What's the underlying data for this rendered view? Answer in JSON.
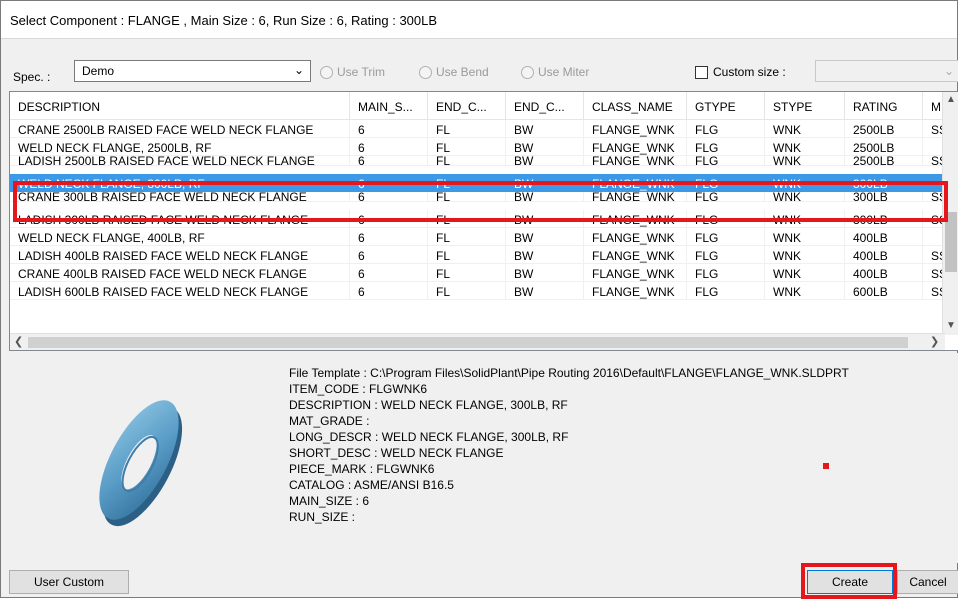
{
  "title": "Select Component : FLANGE , Main Size : 6, Run Size : 6, Rating : 300LB",
  "spec": {
    "label": "Spec. :",
    "selected": "Demo",
    "use_trim": "Use Trim",
    "use_bend": "Use Bend",
    "use_miter": "Use Miter",
    "custom_size": "Custom size :"
  },
  "table": {
    "headers": [
      "DESCRIPTION",
      "MAIN_S...",
      "END_C...",
      "END_C...",
      "CLASS_NAME",
      "GTYPE",
      "STYPE",
      "RATING",
      "M"
    ],
    "rows": [
      [
        "CRANE 2500LB RAISED FACE WELD NECK FLANGE",
        "6",
        "FL",
        "BW",
        "FLANGE_WNK",
        "FLG",
        "WNK",
        "2500LB",
        "SS"
      ],
      [
        "WELD NECK FLANGE, 2500LB, RF",
        "6",
        "FL",
        "BW",
        "FLANGE_WNK",
        "FLG",
        "WNK",
        "2500LB",
        ""
      ],
      [
        "LADISH 2500LB RAISED FACE WELD NECK FLANGE",
        "6",
        "FL",
        "BW",
        "FLANGE_WNK",
        "FLG",
        "WNK",
        "2500LB",
        "SS"
      ],
      [
        "WELD NECK FLANGE, 300LB, RF",
        "6",
        "FL",
        "BW",
        "FLANGE_WNK",
        "FLG",
        "WNK",
        "300LB",
        ""
      ],
      [
        "CRANE 300LB RAISED FACE WELD NECK FLANGE",
        "6",
        "FL",
        "BW",
        "FLANGE_WNK",
        "FLG",
        "WNK",
        "300LB",
        "SS"
      ],
      [
        "LADISH 300LB RAISED FACE WELD NECK FLANGE",
        "6",
        "FL",
        "BW",
        "FLANGE_WNK",
        "FLG",
        "WNK",
        "300LB",
        "SS"
      ],
      [
        "WELD NECK FLANGE, 400LB, RF",
        "6",
        "FL",
        "BW",
        "FLANGE_WNK",
        "FLG",
        "WNK",
        "400LB",
        ""
      ],
      [
        "LADISH 400LB RAISED FACE WELD NECK FLANGE",
        "6",
        "FL",
        "BW",
        "FLANGE_WNK",
        "FLG",
        "WNK",
        "400LB",
        "SS"
      ],
      [
        "CRANE 400LB RAISED FACE WELD NECK FLANGE",
        "6",
        "FL",
        "BW",
        "FLANGE_WNK",
        "FLG",
        "WNK",
        "400LB",
        "SS"
      ],
      [
        "LADISH 600LB RAISED FACE WELD NECK FLANGE",
        "6",
        "FL",
        "BW",
        "FLANGE_WNK",
        "FLG",
        "WNK",
        "600LB",
        "SS"
      ]
    ],
    "selected_index": 3
  },
  "info": {
    "file_template": "File Template : C:\\Program Files\\SolidPlant\\Pipe Routing 2016\\Default\\FLANGE\\FLANGE_WNK.SLDPRT",
    "item_code": "ITEM_CODE : FLGWNK6",
    "description": "DESCRIPTION : WELD NECK FLANGE, 300LB, RF",
    "mat_grade": "MAT_GRADE :",
    "long_descr": "LONG_DESCR : WELD NECK FLANGE, 300LB, RF",
    "short_desc": "SHORT_DESC : WELD NECK FLANGE",
    "piece_mark": "PIECE_MARK : FLGWNK6",
    "catalog": "CATALOG : ASME/ANSI B16.5",
    "main_size": "MAIN_SIZE : 6",
    "run_size": "RUN_SIZE :"
  },
  "buttons": {
    "user_custom": "User Custom",
    "create": "Create",
    "cancel": "Cancel"
  },
  "colors": {
    "selection": "#3b99e8",
    "annotation_red": "#e5171c"
  }
}
